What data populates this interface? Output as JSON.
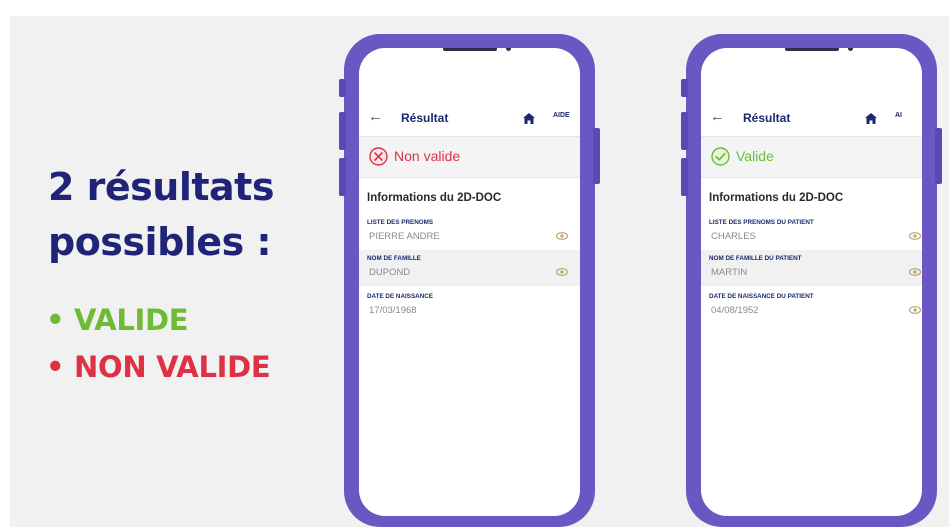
{
  "headline": {
    "line1": "2 résultats",
    "line2": "possibles :"
  },
  "bullets": {
    "valid": "• VALIDE",
    "invalid": "• NON VALIDE"
  },
  "colors": {
    "headline": "#1f2478",
    "valid_green": "#6dbb36",
    "invalid_red": "#df3146",
    "phone_frame": "#6a57c4",
    "navy_text": "#1b2a6e"
  },
  "phone_invalid": {
    "appbar": {
      "back_icon": "arrow-left-icon",
      "title": "Résultat",
      "home_icon": "home-icon",
      "aide": "AIDE"
    },
    "status": {
      "icon": "x-circle-icon",
      "label": "Non valide"
    },
    "section_title": "Informations du 2D-DOC",
    "fields": [
      {
        "label": "LISTE DES PRENOMS",
        "value": "PIERRE ANDRE"
      },
      {
        "label": "NOM DE FAMILLE",
        "value": "DUPOND"
      },
      {
        "label": "DATE DE NAISSANCE",
        "value": "17/03/1968"
      }
    ]
  },
  "phone_valid": {
    "appbar": {
      "back_icon": "arrow-left-icon",
      "title": "Résultat",
      "home_icon": "home-icon",
      "aide": "AI"
    },
    "status": {
      "icon": "check-circle-icon",
      "label": "Valide"
    },
    "section_title": "Informations du 2D-DOC",
    "fields": [
      {
        "label": "LISTE DES PRENOMS DU PATIENT",
        "value": "CHARLES"
      },
      {
        "label": "NOM DE FAMILLE DU PATIENT",
        "value": "MARTIN"
      },
      {
        "label": "DATE DE NAISSANCE DU PATIENT",
        "value": "04/08/1952"
      }
    ]
  }
}
